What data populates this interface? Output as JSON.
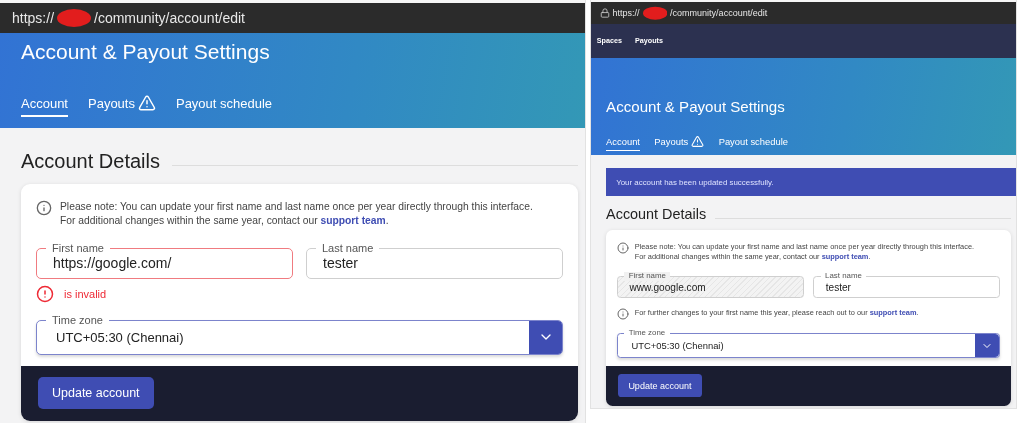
{
  "panels": [
    {
      "address_bar": {
        "lock_icon": false,
        "url_start": "https://",
        "url_end": "/community/account/edit"
      },
      "header": {
        "title": "Account & Payout Settings",
        "tabs": [
          {
            "label": "Account",
            "selected": true,
            "warning": false
          },
          {
            "label": "Payouts",
            "selected": false,
            "warning": true
          },
          {
            "label": "Payout schedule",
            "selected": false,
            "warning": false
          }
        ]
      },
      "section_title": "Account Details",
      "note": {
        "lines": [
          "Please note: You can update your first name and last name once per year directly through this interface.",
          "For additional changes within the same year, contact our"
        ],
        "link": "support team",
        "end": "."
      },
      "fields": [
        {
          "label": "First name",
          "value": "https://google.com/",
          "invalid": true,
          "disabled": false
        },
        {
          "label": "Last name",
          "value": "tester",
          "invalid": false,
          "disabled": false
        }
      ],
      "error": "is invalid",
      "time_zone": {
        "label": "Time zone",
        "value": "UTC+05:30 (Chennai)"
      },
      "button": "Update account"
    },
    {
      "address_bar": {
        "lock_icon": true,
        "url_start": "https://",
        "url_end": "/community/account/edit"
      },
      "nav": [
        "Spaces",
        "Payouts"
      ],
      "header": {
        "title": "Account & Payout Settings",
        "tabs": [
          {
            "label": "Account",
            "selected": true,
            "warning": false
          },
          {
            "label": "Payouts",
            "selected": false,
            "warning": true
          },
          {
            "label": "Payout schedule",
            "selected": false,
            "warning": false
          }
        ]
      },
      "alert": "Your account has been updated successfully.",
      "section_title": "Account Details",
      "note": {
        "lines": [
          "Please note: You can update your first name and last name once per year directly through this interface.",
          "For additional changes within the same year, contact our"
        ],
        "link": "support team",
        "end": "."
      },
      "fields": [
        {
          "label": "First name",
          "value": "www.google.com",
          "invalid": false,
          "disabled": true
        },
        {
          "label": "Last name",
          "value": "tester",
          "invalid": false,
          "disabled": false
        }
      ],
      "hint": {
        "text": "For further changes to your first name this year, please reach out to our",
        "link": "support team",
        "end": "."
      },
      "time_zone": {
        "label": "Time zone",
        "value": "UTC+05:30 (Chennai)"
      },
      "button": "Update account"
    }
  ]
}
